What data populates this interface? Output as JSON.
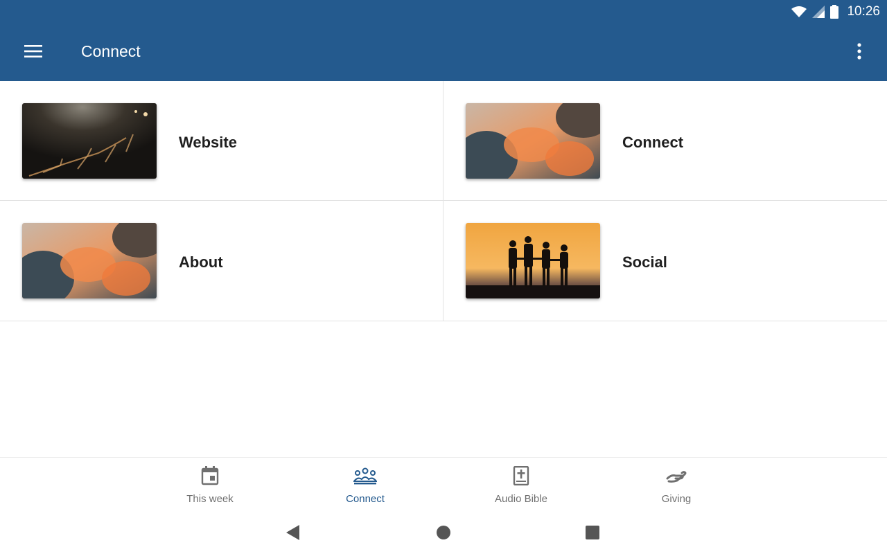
{
  "status": {
    "time": "10:26"
  },
  "appbar": {
    "title": "Connect"
  },
  "tiles": [
    {
      "label": "Website"
    },
    {
      "label": "Connect"
    },
    {
      "label": "About"
    },
    {
      "label": "Social"
    }
  ],
  "bottom_nav": {
    "items": [
      {
        "label": "This week",
        "icon": "calendar-icon"
      },
      {
        "label": "Connect",
        "icon": "people-icon",
        "active": true
      },
      {
        "label": "Audio Bible",
        "icon": "bible-icon"
      },
      {
        "label": "Giving",
        "icon": "giving-hand-icon"
      }
    ]
  },
  "colors": {
    "primary": "#245a8e",
    "inactive": "#6f6f6f"
  }
}
